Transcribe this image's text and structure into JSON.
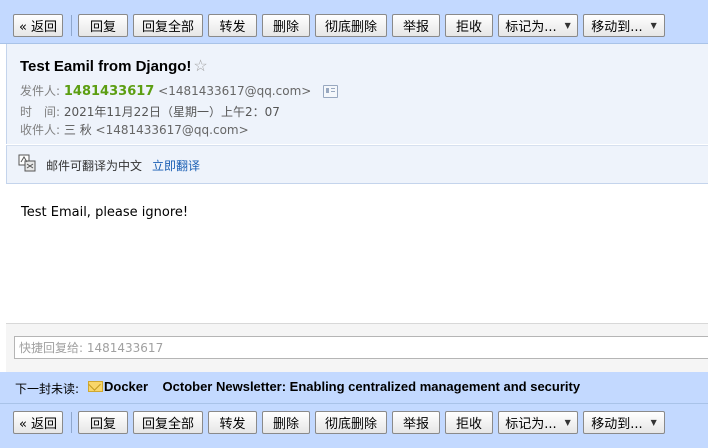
{
  "toolbar": {
    "back": "« 返回",
    "reply": "回复",
    "reply_all": "回复全部",
    "forward": "转发",
    "delete": "删除",
    "delete_permanent": "彻底删除",
    "report": "举报",
    "reject": "拒收",
    "mark_as": "标记为...",
    "move_to": "移动到..."
  },
  "mail": {
    "subject": "Test Eamil from Django!",
    "sender_label": "发件人:",
    "sender_name": "1481433617",
    "sender_address": "<1481433617@qq.com>",
    "time_label": "时　间:",
    "time_value": "2021年11月22日（星期一）上午2：07",
    "recipient_label": "收件人:",
    "recipient_name": "三 秋",
    "recipient_address": "<1481433617@qq.com>",
    "body": "Test Email, please ignore!"
  },
  "translate": {
    "text": "邮件可翻译为中文",
    "link": "立即翻译"
  },
  "quick_reply": {
    "placeholder": "快捷回复给: 1481433617"
  },
  "next_mail": {
    "label": "下一封未读:",
    "subject": "Docker    October Newsletter: Enabling centralized management and security"
  },
  "colors": {
    "toolbar_bg": "#c3d9ff",
    "sender_green": "#5c9e12",
    "link_blue": "#1a5fb4"
  }
}
